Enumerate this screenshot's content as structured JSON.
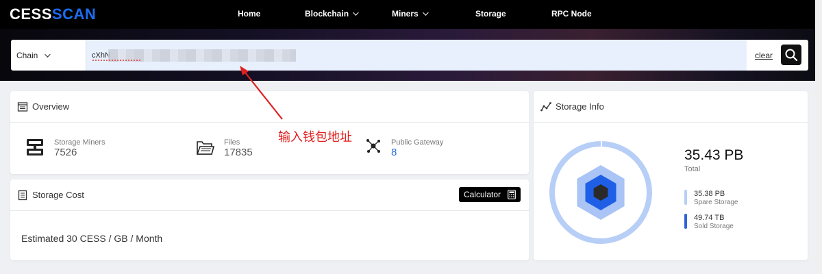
{
  "brand": {
    "part1": "CESS",
    "part2": "SCAN"
  },
  "nav": [
    {
      "label": "Home",
      "dropdown": false
    },
    {
      "label": "Blockchain",
      "dropdown": true
    },
    {
      "label": "Miners",
      "dropdown": true
    },
    {
      "label": "Storage",
      "dropdown": false
    },
    {
      "label": "RPC Node",
      "dropdown": false
    }
  ],
  "search": {
    "chain_select": "Chain",
    "value": "cXhN",
    "clear_label": "clear",
    "icon": "search-icon"
  },
  "annotation": {
    "text": "输入钱包地址",
    "color": "#e02020"
  },
  "overview": {
    "title": "Overview",
    "stats": [
      {
        "label": "Storage Miners",
        "value": "7526",
        "icon": "server-icon"
      },
      {
        "label": "Files",
        "value": "17835",
        "icon": "folder-icon"
      },
      {
        "label": "Public Gateway",
        "value": "8",
        "icon": "network-icon"
      }
    ]
  },
  "storage_cost": {
    "title": "Storage Cost",
    "calculator_label": "Calculator",
    "estimate": "Estimated 30 CESS / GB / Month"
  },
  "storage_info": {
    "title": "Storage Info",
    "total_value": "35.43 PB",
    "total_label": "Total",
    "legend": [
      {
        "value": "35.38 PB",
        "label": "Spare Storage",
        "color": "#b7cff7"
      },
      {
        "value": "49.74 TB",
        "label": "Sold Storage",
        "color": "#2f64d8"
      }
    ]
  },
  "colors": {
    "accent": "#1d6cf0",
    "link": "#2e6fd6"
  }
}
